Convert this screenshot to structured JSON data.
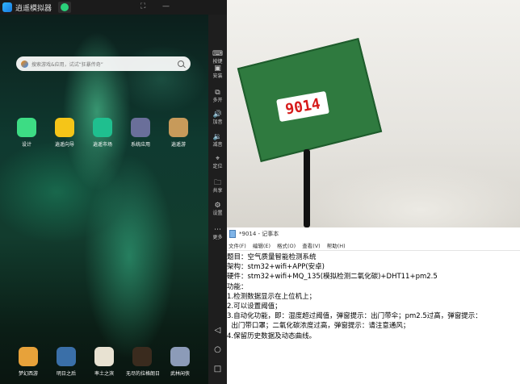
{
  "emulator": {
    "title": "逍遥模拟器",
    "search": {
      "placeholder": "搜索游戏&应用，试试“狂暴传奇”"
    },
    "apps_row1": [
      {
        "label": "设计",
        "icon": "android-icon",
        "color": "#3ddc84"
      },
      {
        "label": "逍遥向导",
        "icon": "lightbulb-icon",
        "color": "#f5c518"
      },
      {
        "label": "逍遥市场",
        "icon": "store-icon",
        "color": "#1fbf8f"
      },
      {
        "label": "系统应用",
        "icon": "system-apps-icon",
        "color": "#6a6f9a"
      },
      {
        "label": "逍遥游",
        "icon": "game-icon",
        "color": "#c79a5a"
      }
    ],
    "apps_dock": [
      {
        "label": "梦幻西游",
        "icon": "game-icon",
        "color": "#e7a23a"
      },
      {
        "label": "明日之后",
        "icon": "game-icon",
        "color": "#3a6fa8"
      },
      {
        "label": "率土之滨",
        "icon": "game-icon",
        "color": "#e8e2d2"
      },
      {
        "label": "无尽的拉格朗日",
        "icon": "game-icon",
        "color": "#3a2b1e"
      },
      {
        "label": "武林闲侠",
        "icon": "game-icon",
        "color": "#8c9bb8"
      }
    ],
    "sidebar": [
      {
        "label": "按键",
        "glyph": "⌨"
      },
      {
        "label": "安装",
        "glyph": "▣"
      },
      {
        "label": "多开",
        "glyph": "⧉"
      },
      {
        "label": "加音",
        "glyph": "🔊"
      },
      {
        "label": "减音",
        "glyph": "🔉"
      },
      {
        "label": "定位",
        "glyph": "⌖"
      },
      {
        "label": "共享",
        "glyph": "🗀"
      },
      {
        "label": "设置",
        "glyph": "⚙"
      },
      {
        "label": "更多",
        "glyph": "⋯"
      }
    ],
    "nav": {
      "back": "◁",
      "home": "○",
      "recent": "□"
    }
  },
  "photo": {
    "sticker_text": "9014"
  },
  "notepad": {
    "title": "*9014 - 记事本",
    "menu": [
      "文件(F)",
      "编辑(E)",
      "格式(O)",
      "查看(V)",
      "帮助(H)"
    ],
    "lines": [
      "题目：空气质量智能检测系统",
      "架构：stm32+wifi+APP(安卓)",
      "硬件：stm32+wifi+MQ_135(模拟检测二氧化碳)+DHT11+pm2.5",
      "功能：",
      "1.检测数据显示在上位机上；",
      "2.可以设置阈值；",
      "3.自动化功能，即：湿度超过阈值，弹窗提示：出门带伞；pm2.5过高，弹窗提示：",
      "  出门带口罩；二氧化碳浓度过高，弹窗提示：请注意通风；",
      "4.保留历史数据及动态曲线。"
    ]
  }
}
